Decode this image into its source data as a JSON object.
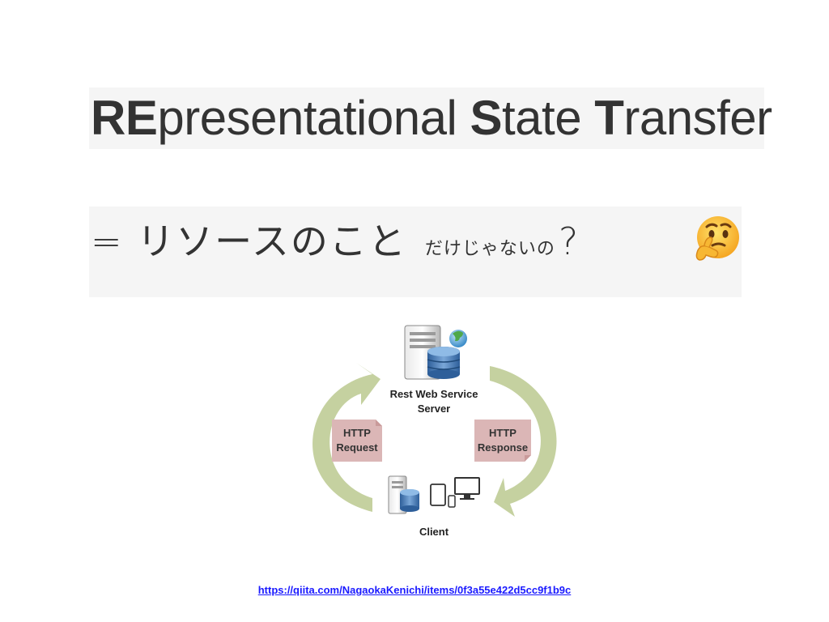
{
  "title": {
    "parts": [
      {
        "text": "RE",
        "bold": true
      },
      {
        "text": "presentational ",
        "bold": false
      },
      {
        "text": "S",
        "bold": true
      },
      {
        "text": "tate ",
        "bold": false
      },
      {
        "text": "T",
        "bold": true
      },
      {
        "text": "ransfer",
        "bold": false
      }
    ]
  },
  "subtitle": {
    "main": "= リソースのこと",
    "small": "だけじゃないの",
    "question": "?",
    "emoji_icon": "thinking-face-icon"
  },
  "diagram": {
    "server_label_line1": "Rest Web Service",
    "server_label_line2": "Server",
    "request_line1": "HTTP",
    "request_line2": "Request",
    "response_line1": "HTTP",
    "response_line2": "Response",
    "client_label": "Client"
  },
  "source_url": "https://qiita.com/NagaokaKenichi/items/0f3a55e422d5cc9f1b9c",
  "colors": {
    "box_bg": "#f5f5f5",
    "arrow": "#c5d1a0",
    "http_box": "#dbb6b6",
    "link": "#1a1aff",
    "text": "#333333"
  }
}
